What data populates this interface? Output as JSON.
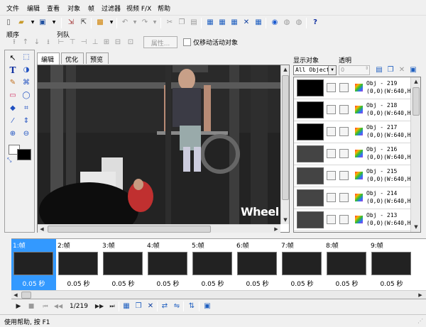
{
  "menu": [
    "文件",
    "编辑",
    "查看",
    "对象",
    "帧",
    "过滤器",
    "视频 F/X",
    "帮助"
  ],
  "order_toolbar": {
    "order_label": "顺序",
    "align_label": "列队",
    "props_button": "属性...",
    "move_active_label": "仅移动活动对象"
  },
  "editor_tabs": [
    "编辑",
    "优化",
    "预览"
  ],
  "video_overlay_text": "Wheel",
  "objects_panel": {
    "show_label": "显示对象",
    "opacity_label": "透明",
    "filter_value": "All Objects",
    "opacity_value": "0",
    "rows": [
      {
        "name": "Obj - 219",
        "info": "(0,0)(W:640,H:"
      },
      {
        "name": "Obj - 218",
        "info": "(0,0)(W:640,H:"
      },
      {
        "name": "Obj - 217",
        "info": "(0,0)(W:640,H:"
      },
      {
        "name": "Obj - 216",
        "info": "(0,0)(W:640,H:"
      },
      {
        "name": "Obj - 215",
        "info": "(0,0)(W:640,H:"
      },
      {
        "name": "Obj - 214",
        "info": "(0,0)(W:640,H:"
      },
      {
        "name": "Obj - 213",
        "info": "(0,0)(W:640,H:"
      }
    ]
  },
  "frames": [
    {
      "label": "1:帧",
      "duration": "0.05 秒"
    },
    {
      "label": "2:帧",
      "duration": "0.05 秒"
    },
    {
      "label": "3:帧",
      "duration": "0.05 秒"
    },
    {
      "label": "4:帧",
      "duration": "0.05 秒"
    },
    {
      "label": "5:帧",
      "duration": "0.05 秒"
    },
    {
      "label": "6:帧",
      "duration": "0.05 秒"
    },
    {
      "label": "7:帧",
      "duration": "0.05 秒"
    },
    {
      "label": "8:帧",
      "duration": "0.05 秒"
    },
    {
      "label": "9:帧",
      "duration": "0.05 秒"
    }
  ],
  "playback": {
    "frame_counter": "1/219"
  },
  "status": {
    "text": "使用帮助, 按 F1"
  }
}
